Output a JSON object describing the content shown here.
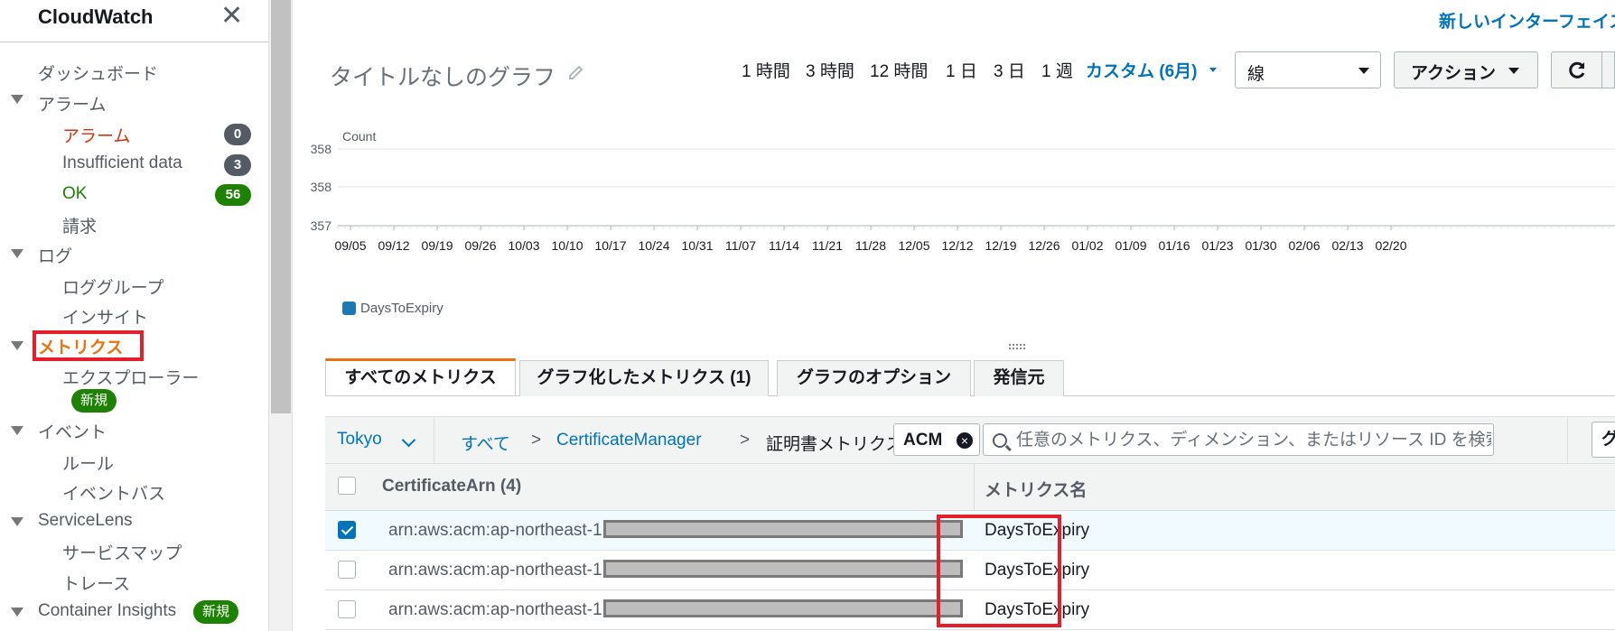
{
  "sidebar": {
    "title": "CloudWatch",
    "close_glyph": "✕",
    "items": [
      {
        "label": "ダッシュボード",
        "color": "#545b64"
      },
      {
        "label": "アラーム",
        "color": "#545b64"
      },
      {
        "label": "アラーム",
        "color": "#d13212",
        "badge": "0"
      },
      {
        "label": "Insufficient data",
        "color": "#545b64",
        "badge": "3"
      },
      {
        "label": "OK",
        "color": "#1d8102",
        "badge": "56"
      },
      {
        "label": "請求",
        "color": "#545b64"
      },
      {
        "label": "ログ",
        "color": "#545b64"
      },
      {
        "label": "ロググループ",
        "color": "#545b64"
      },
      {
        "label": "インサイト",
        "color": "#545b64"
      },
      {
        "label": "メトリクス",
        "color": "#ec7211"
      },
      {
        "label": "エクスプローラー",
        "color": "#545b64",
        "badge": "新規"
      },
      {
        "label": "イベント",
        "color": "#545b64"
      },
      {
        "label": "ルール",
        "color": "#545b64"
      },
      {
        "label": "イベントバス",
        "color": "#545b64"
      },
      {
        "label": "ServiceLens",
        "color": "#545b64"
      },
      {
        "label": "サービスマップ",
        "color": "#545b64"
      },
      {
        "label": "トレース",
        "color": "#545b64"
      },
      {
        "label": "Container Insights",
        "color": "#545b64",
        "badge": "新規"
      }
    ]
  },
  "header": {
    "new_interface_link": "新しいインターフェイス",
    "graph_title": "タイトルなしのグラフ",
    "time_ranges": [
      "1 時間",
      "3 時間",
      "12 時間",
      "1 日",
      "3 日",
      "1 週"
    ],
    "custom_range": "カスタム (6月)",
    "chart_type_value": "線",
    "actions_label": "アクション"
  },
  "chart_data": {
    "type": "line",
    "ylabel": "Count",
    "y_ticks": [
      "358",
      "358",
      "357"
    ],
    "x": [
      "09/05",
      "09/12",
      "09/19",
      "09/26",
      "10/03",
      "10/10",
      "10/17",
      "10/24",
      "10/31",
      "11/07",
      "11/14",
      "11/21",
      "11/28",
      "12/05",
      "12/12",
      "12/19",
      "12/26",
      "01/02",
      "01/09",
      "01/16",
      "01/23",
      "01/30",
      "02/06",
      "02/13",
      "02/20"
    ],
    "series": [
      {
        "name": "DaysToExpiry",
        "color": "#1f77b4"
      }
    ],
    "grid": true,
    "legend": "bottom-left"
  },
  "tabs": [
    {
      "label": "すべてのメトリクス",
      "active": true
    },
    {
      "label": "グラフ化したメトリクス (1)",
      "active": false
    },
    {
      "label": "グラフのオプション",
      "active": false
    },
    {
      "label": "発信元",
      "active": false
    }
  ],
  "filter": {
    "region": "Tokyo",
    "breadcrumbs": [
      "すべて",
      "CertificateManager",
      "証明書メトリクス"
    ],
    "separator": ">",
    "token": "ACM",
    "token_remove_glyph": "×",
    "search_placeholder": "任意のメトリクス、ディメンション、またはリソース ID を検索",
    "graph_search_label": "グラフ検索"
  },
  "table": {
    "columns": [
      "CertificateArn (4)",
      "メトリクス名"
    ],
    "rows": [
      {
        "arn_prefix": "arn:aws:acm:ap-northeast-1:",
        "metric": "DaysToExpiry",
        "checked": true
      },
      {
        "arn_prefix": "arn:aws:acm:ap-northeast-1:",
        "metric": "DaysToExpiry",
        "checked": false
      },
      {
        "arn_prefix": "arn:aws:acm:ap-northeast-1:",
        "metric": "DaysToExpiry",
        "checked": false
      }
    ]
  },
  "colors": {
    "link": "#0073bb",
    "accent": "#ec7211",
    "highlight": "#e41e2a",
    "alarm": "#d13212",
    "ok": "#1d8102"
  }
}
